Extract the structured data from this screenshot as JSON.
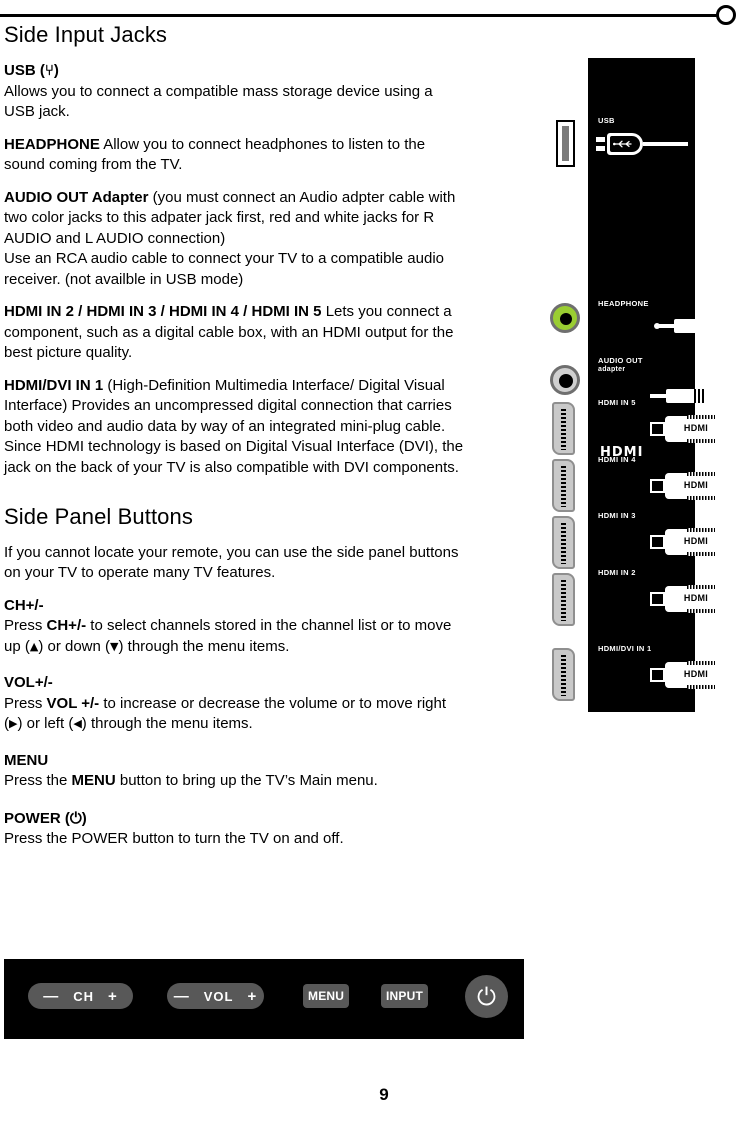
{
  "page": {
    "number": "9"
  },
  "sections": [
    {
      "id": "side-input-jacks",
      "title": "Side Input Jacks"
    },
    {
      "id": "side-panel-buttons",
      "title": "Side Panel Buttons"
    }
  ],
  "jacks": {
    "usb": {
      "term": "USB (",
      "term_close": ")",
      "symbol": "⑂",
      "body": "Allows you to connect a compatible mass storage device using a USB jack."
    },
    "headphone": {
      "term": "HEADPHONE",
      "body": " Allow you to connect headphones to listen to the sound coming from the TV."
    },
    "audio_out": {
      "term": "AUDIO OUT Adapter",
      "body": "  (you must connect an Audio adpter cable with two color jacks to this adpater jack first, red and white jacks for R AUDIO and L AUDIO connection)",
      "body2": "Use an RCA audio cable to connect your TV to a compatible audio receiver. (not availble in USB mode)"
    },
    "hdmi_in_2345": {
      "term": "HDMI IN 2 / HDMI IN 3 / HDMI IN 4 / HDMI IN 5",
      "body": "  Lets you connect a component, such as a digital cable box, with an HDMI output for the best picture quality."
    },
    "hdmi_dvi_in_1": {
      "term": "HDMI/DVI IN 1",
      "body": " (High-Definition Multimedia Interface/ Digital Visual Interface) Provides an uncompressed digital connection that carries both video and audio data by way of an integrated mini-plug cable. Since HDMI technology is based on Digital Visual Interface (DVI), the jack on the back of your TV is also compatible with DVI components."
    }
  },
  "buttons_section": {
    "intro": "If you cannot locate your remote, you can use the side panel buttons on your TV to operate many TV features.",
    "items": [
      {
        "term": "CH+/-",
        "line_prefix": "Press ",
        "line_bold": "CH+/-",
        "line_mid": " to select channels stored in the channel list or to move up (",
        "arrow_up": "▲",
        "line_mid2": ") or down (",
        "arrow_down": "▼",
        "line_suffix": ") through the menu items."
      },
      {
        "term": "VOL+/-",
        "line_prefix": "Press ",
        "line_bold": "VOL +/-",
        "line_mid": " to increase or decrease the volume or to move right (",
        "arrow_right": "▶",
        "line_mid2": ") or left (",
        "arrow_left": "◀",
        "line_suffix": ") through the menu items."
      },
      {
        "term": "MENU",
        "line_prefix": "Press the ",
        "line_bold": "MENU",
        "line_suffix": " button to bring up the TV’s Main menu."
      },
      {
        "term_prefix": "POWER (",
        "term_symbol": "⏻",
        "term_suffix": ")",
        "line_plain": "Press the POWER button to turn the TV on and off."
      }
    ]
  },
  "diagram": {
    "panel_color": "#000000",
    "connectors": [
      {
        "id": "usb",
        "label": "USB",
        "sub": "",
        "plug_text": ""
      },
      {
        "id": "headphone",
        "label": "HEADPHONE",
        "sub": "",
        "plug_text": ""
      },
      {
        "id": "audio-out",
        "label": "AUDIO OUT",
        "sub": "adapter",
        "plug_text": ""
      },
      {
        "id": "hdmi-in-5",
        "label": "HDMI IN 5",
        "sub": "",
        "plug_text": "HDMI"
      },
      {
        "id": "hdmi-in-4",
        "label": "HDMI IN 4",
        "sub": "",
        "plug_text": "HDMI"
      },
      {
        "id": "hdmi-in-3",
        "label": "HDMI IN 3",
        "sub": "",
        "plug_text": "HDMI"
      },
      {
        "id": "hdmi-in-2",
        "label": "HDMI IN 2",
        "sub": "",
        "plug_text": "HDMI"
      },
      {
        "id": "hdmi-dvi-1",
        "label": "HDMI/DVI IN 1",
        "sub": "",
        "plug_text": "HDMI"
      }
    ],
    "wordmark": "HDMI",
    "jack_colors": {
      "headphone": "#9acd32",
      "audio_out": "#d0d0d0",
      "hdmi": "#c9c9c9"
    }
  },
  "control_bar": {
    "background": "#000000",
    "button_color": "#585858",
    "channel": {
      "minus": "—",
      "label": "CH",
      "plus": "+"
    },
    "volume": {
      "minus": "—",
      "label": "VOL",
      "plus": "+"
    },
    "menu": {
      "label": "MENU"
    },
    "input": {
      "label": "INPUT"
    },
    "power": {
      "symbol": "⏻"
    }
  }
}
